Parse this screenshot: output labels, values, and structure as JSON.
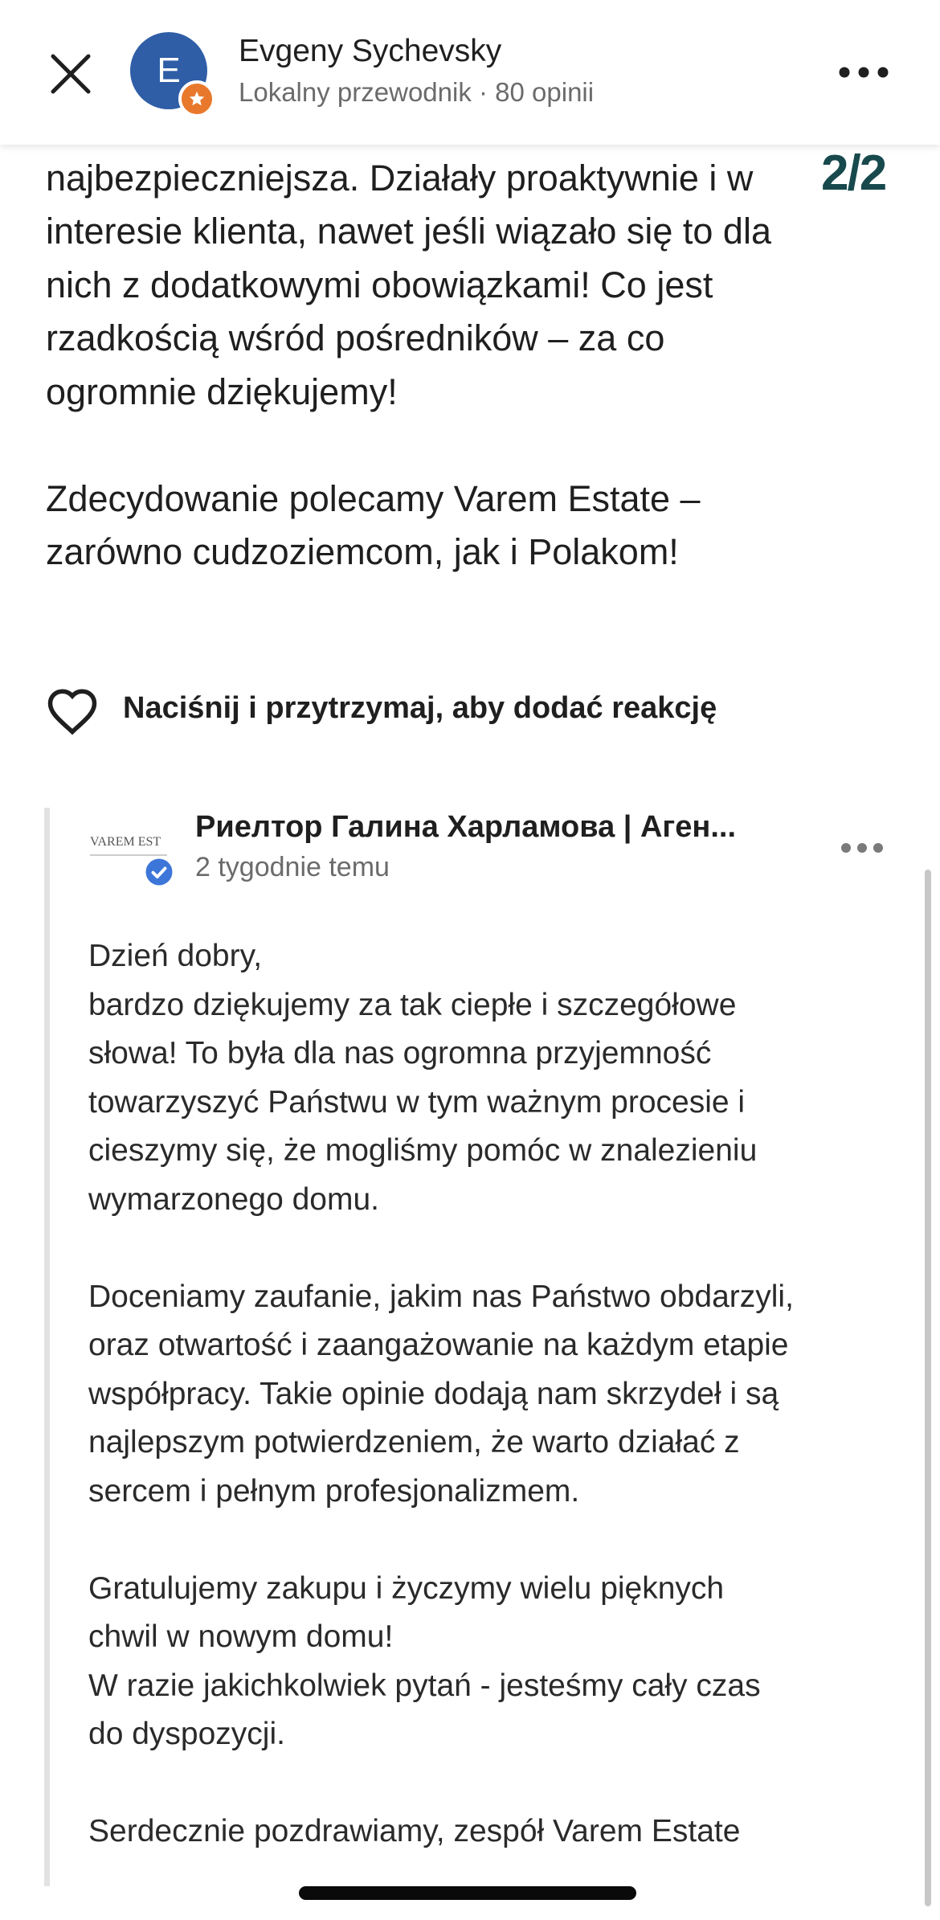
{
  "header": {
    "avatar_letter": "E",
    "author_name": "Evgeny Sychevsky",
    "author_subtitle": "Lokalny przewodnik · 80 opinii",
    "icons": {
      "close": "close-icon",
      "more": "more-options-icon",
      "badge": "local-guide-star-icon"
    }
  },
  "page_counter": "2/2",
  "review": {
    "text": "korygowały umowę, by była dla nas jak\nnajbezpieczniejsza. Działały proaktywnie i w\ninteresie klienta, nawet jeśli wiązało się to dla\nnich z dodatkowymi obowiązkami! Co jest\nrzadkością wśród pośredników – za co\nogromnie dziękujemy!\n\nZdecydowanie polecamy Varem Estate –\nzarówno cudzoziemcom, jak i Polakom!"
  },
  "reaction": {
    "label": "Naciśnij i przytrzymaj, aby dodać reakcję",
    "icon": "heart-outline-icon"
  },
  "reply": {
    "logo_text": "VAREM EST",
    "owner_name": "Риелтор Галина Харламова | Аген...",
    "date": "2 tygodnie temu",
    "text": "Dzień dobry,\nbardzo dziękujemy za tak ciepłe i szczegółowe\nsłowa! To była dla nas ogromna przyjemność\ntowarzyszyć Państwu w tym ważnym procesie i\ncieszymy się, że mogliśmy pomóc w znalezieniu\nwymarzonego domu.\n\nDoceniamy zaufanie, jakim nas Państwo obdarzyli,\noraz otwartość i zaangażowanie na każdym etapie\nwspółpracy. Takie opinie dodają nam skrzydeł i są\nnajlepszym potwierdzeniem, że warto działać z\nsercem i pełnym profesjonalizmem.\n\nGratulujemy zakupu i życzymy wielu pięknych\nchwil w nowym domu!\nW razie jakichkolwiek pytań - jesteśmy cały czas\ndo dyspozycji.\n\nSerdecznie pozdrawiamy, zespół Varem Estate",
    "icons": {
      "verified": "verified-badge-icon",
      "more": "more-options-icon"
    }
  },
  "colors": {
    "avatar": "#2f5ea7",
    "badge": "#e8792c",
    "page_counter": "#17494d",
    "verified": "#3d76d9",
    "secondary_text": "#6b6b6b"
  }
}
